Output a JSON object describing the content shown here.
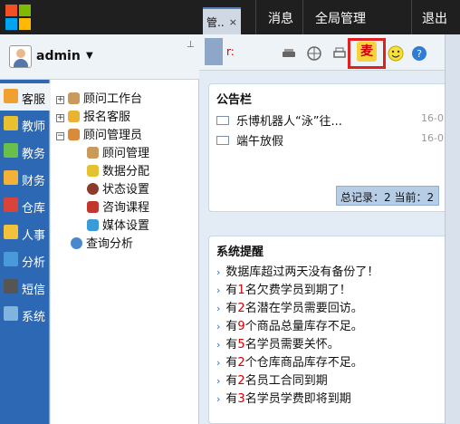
{
  "window": {
    "tab_label": "管..",
    "tab_close": "×"
  },
  "topnav": {
    "messages": "消息",
    "global_admin": "全局管理",
    "logout": "退出"
  },
  "user": {
    "name": "admin",
    "caret": "▼",
    "pin": "⊥"
  },
  "rail": [
    {
      "label": "客服",
      "icon": "customer-service-icon",
      "color": "#f0a030"
    },
    {
      "label": "教师",
      "icon": "teacher-icon",
      "color": "#e8c030"
    },
    {
      "label": "教务",
      "icon": "academic-icon",
      "color": "#6abf4b"
    },
    {
      "label": "财务",
      "icon": "finance-icon",
      "color": "#f2b23a"
    },
    {
      "label": "仓库",
      "icon": "warehouse-icon",
      "color": "#d9433a"
    },
    {
      "label": "人事",
      "icon": "hr-icon",
      "color": "#f2c23a"
    },
    {
      "label": "分析",
      "icon": "analysis-icon",
      "color": "#4a9ad9"
    },
    {
      "label": "短信",
      "icon": "sms-icon",
      "color": "#555555"
    },
    {
      "label": "系统",
      "icon": "system-icon",
      "color": "#7fb3e0"
    }
  ],
  "tree": {
    "advisor_workbench": "顾问工作台",
    "registration_service": "报名客服",
    "advisor_admin": "顾问管理员",
    "children": [
      "顾问管理",
      "数据分配",
      "状态设置",
      "咨询课程",
      "媒体设置"
    ],
    "query_analysis": "查询分析"
  },
  "toolbar": {
    "red_text": "r:",
    "mai_label": "麦"
  },
  "bulletin": {
    "title": "公告栏",
    "items": [
      {
        "text": "乐博机器人“泳”往...",
        "date": "16-0"
      },
      {
        "text": "端午放假",
        "date": "16-0"
      }
    ],
    "pager": "总记录：2 当前：2"
  },
  "system": {
    "title": "系统提醒",
    "items": [
      {
        "pre": "数据库超过两天没有备份了！",
        "num": "",
        "post": ""
      },
      {
        "pre": "有",
        "num": "1",
        "post": "名欠费学员到期了！"
      },
      {
        "pre": "有",
        "num": "2",
        "post": "名潜在学员需要回访。"
      },
      {
        "pre": "有",
        "num": "9",
        "post": "个商品总量库存不足。"
      },
      {
        "pre": "有",
        "num": "5",
        "post": "名学员需要关怀。"
      },
      {
        "pre": "有",
        "num": "2",
        "post": "个仓库商品库存不足。"
      },
      {
        "pre": "有",
        "num": "2",
        "post": "名员工合同到期"
      },
      {
        "pre": "有",
        "num": "3",
        "post": "名学员学费即将到期"
      }
    ]
  },
  "colors": {
    "topbar": "#1f1f1f",
    "rail": "#2c68b3",
    "highlight": "#e02020"
  }
}
